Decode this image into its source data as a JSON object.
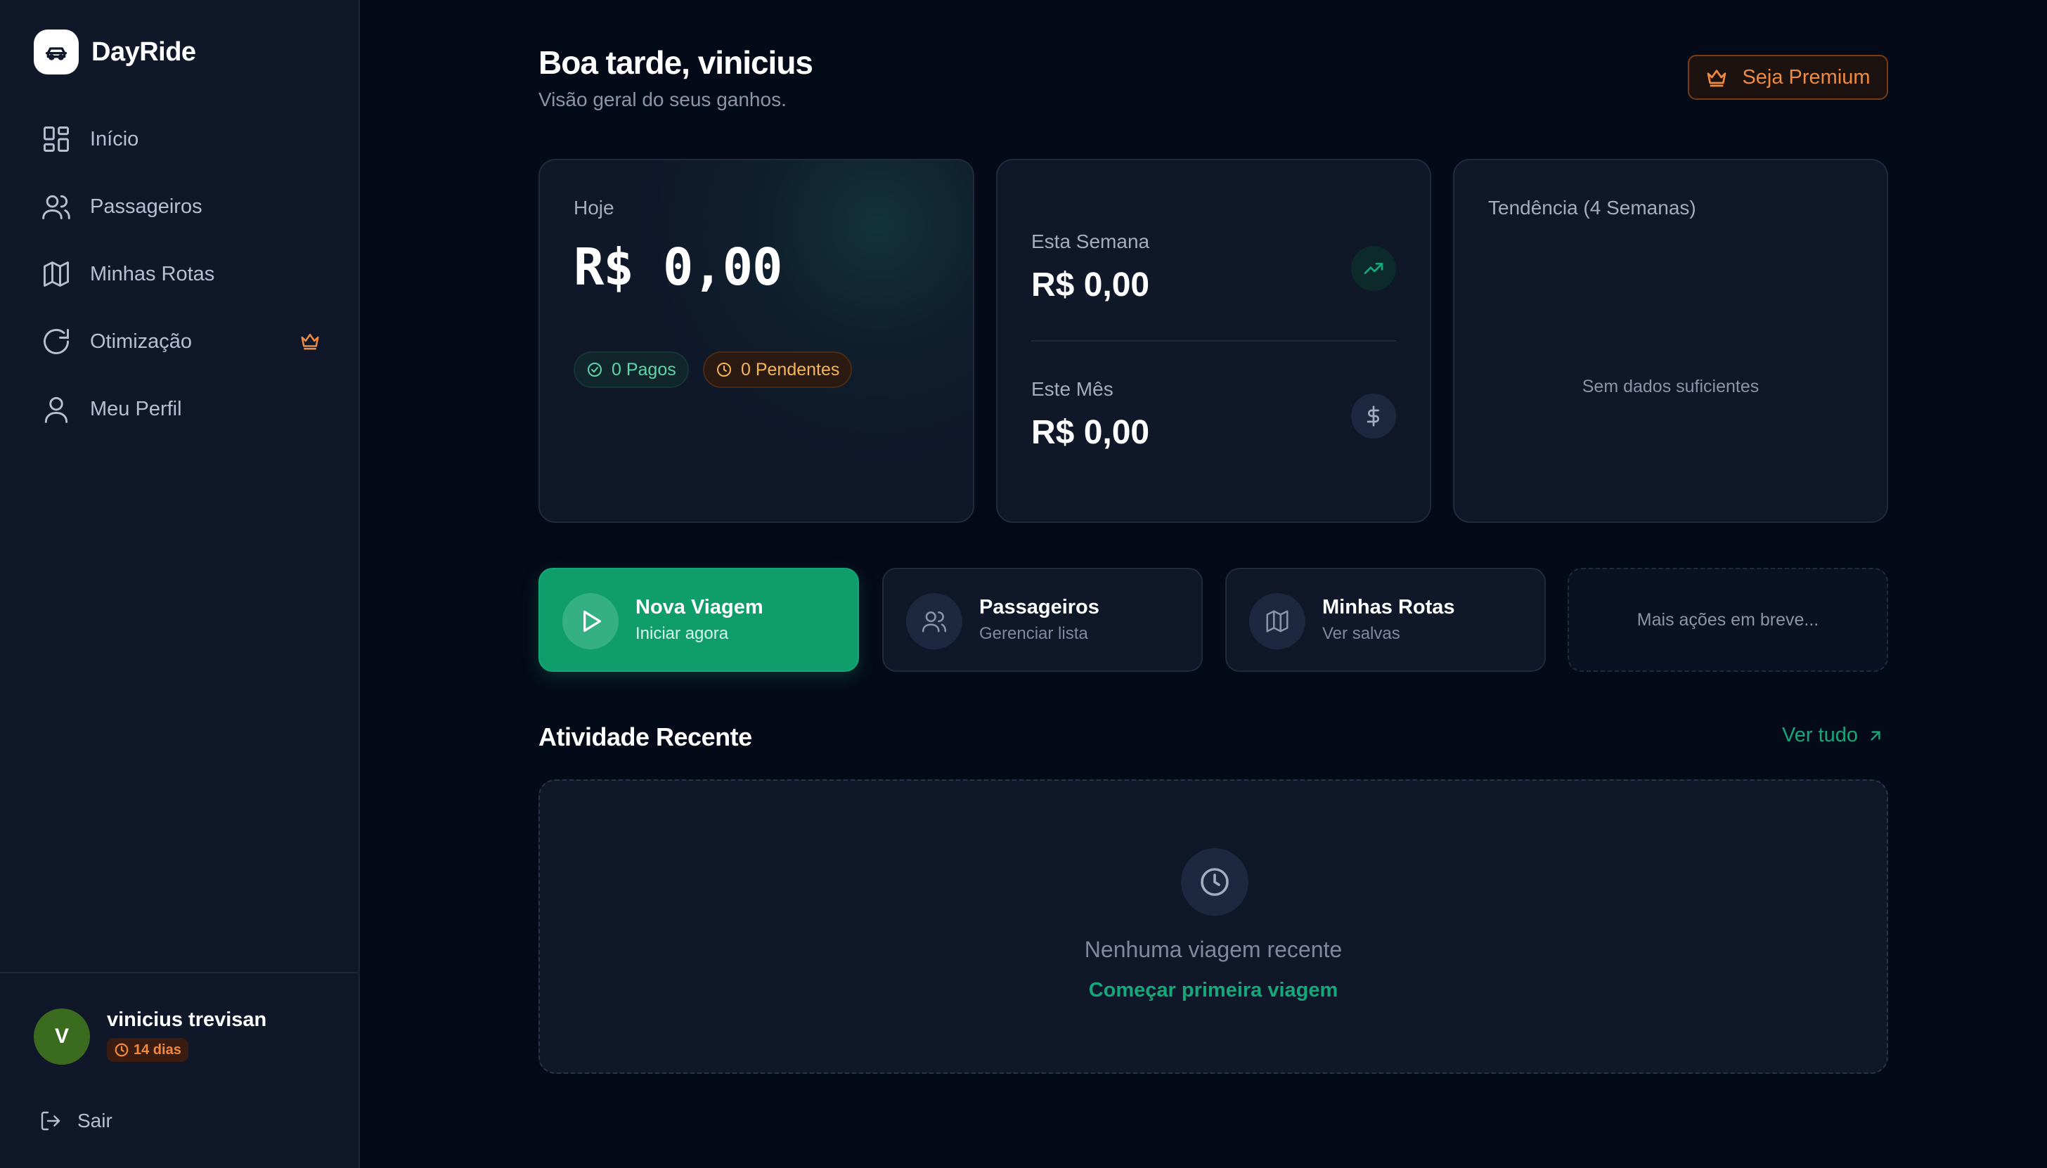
{
  "app": {
    "name": "DayRide"
  },
  "sidebar": {
    "items": [
      {
        "label": "Início",
        "icon": "grid-icon"
      },
      {
        "label": "Passageiros",
        "icon": "users-icon"
      },
      {
        "label": "Minhas Rotas",
        "icon": "map-icon"
      },
      {
        "label": "Otimização",
        "icon": "refresh-icon",
        "premium": true
      },
      {
        "label": "Meu Perfil",
        "icon": "user-icon"
      }
    ],
    "user": {
      "initial": "V",
      "name": "vinicius trevisan",
      "trial": "14 dias"
    },
    "logout_label": "Sair"
  },
  "header": {
    "greeting": "Boa tarde, vinicius",
    "subtitle": "Visão geral do seus ganhos.",
    "premium_label": "Seja Premium"
  },
  "stats": {
    "today": {
      "label": "Hoje",
      "value": "R$ 0,00",
      "paid": "0 Pagos",
      "pending": "0 Pendentes"
    },
    "week": {
      "label": "Esta Semana",
      "value": "R$ 0,00"
    },
    "month": {
      "label": "Este Mês",
      "value": "R$ 0,00"
    },
    "trend": {
      "label": "Tendência (4 Semanas)",
      "empty": "Sem dados suficientes"
    }
  },
  "actions": [
    {
      "title": "Nova Viagem",
      "subtitle": "Iniciar agora"
    },
    {
      "title": "Passageiros",
      "subtitle": "Gerenciar lista"
    },
    {
      "title": "Minhas Rotas",
      "subtitle": "Ver salvas"
    }
  ],
  "actions_soon": "Mais ações em breve...",
  "recent": {
    "title": "Atividade Recente",
    "see_all": "Ver tudo",
    "empty": "Nenhuma viagem recente",
    "cta": "Começar primeira viagem"
  },
  "colors": {
    "accent": "#0f9d6b",
    "premium": "#f08a3e",
    "background": "#050a18",
    "sidebar": "#0f1729"
  }
}
